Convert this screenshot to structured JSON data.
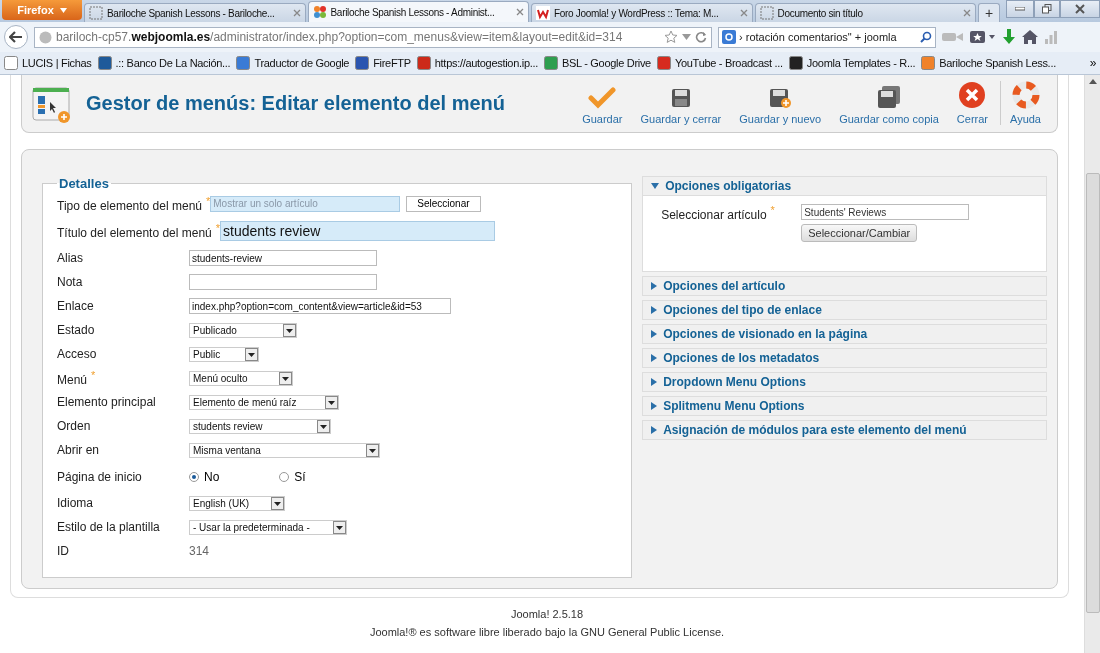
{
  "browser": {
    "menu_button": "Firefox",
    "tabs": [
      {
        "title": "Bariloche Spanish Lessons - Bariloche...",
        "selected": false,
        "kind": "blank"
      },
      {
        "title": "Bariloche Spanish Lessons - Administ...",
        "selected": true,
        "kind": "joomla"
      },
      {
        "title": "Foro Joomla! y WordPress :: Tema: M...",
        "selected": false,
        "kind": "forum"
      },
      {
        "title": "Documento sin título",
        "selected": false,
        "kind": "blank"
      }
    ],
    "new_tab": "+",
    "url": "bariloch-cp57.**webjoomla.es**/administrator/index.php?option=com_menus&view=item&layout=edit&id=314",
    "search": "› rotación comentarios\" + joomla",
    "bookmarks": [
      {
        "label": "LUCIS | Fichas",
        "color": "#ffffff"
      },
      {
        "label": ".:: Banco De La Nación...",
        "color": "#1f5a9a"
      },
      {
        "label": "Traductor de Google",
        "color": "#3a7bd5"
      },
      {
        "label": "FireFTP",
        "color": "#2a55b0"
      },
      {
        "label": "https://autogestion.ip...",
        "color": "#cc2a1a"
      },
      {
        "label": "BSL - Google Drive",
        "color": "#2e9e4f"
      },
      {
        "label": "YouTube - Broadcast ...",
        "color": "#d62b1f"
      },
      {
        "label": "Joomla Templates - R...",
        "color": "#222222"
      },
      {
        "label": "Bariloche Spanish Less...",
        "color": "#f0822a"
      }
    ],
    "more": "»"
  },
  "header": {
    "title": "Gestor de menús: Editar elemento del menú",
    "toolbar": [
      {
        "label": "Guardar",
        "kind": "check"
      },
      {
        "label": "Guardar y cerrar",
        "kind": "save"
      },
      {
        "label": "Guardar y nuevo",
        "kind": "save-new"
      },
      {
        "label": "Guardar como copia",
        "kind": "copy"
      },
      {
        "label": "Cerrar",
        "kind": "close"
      },
      {
        "label": "Ayuda",
        "kind": "help"
      }
    ]
  },
  "details": {
    "legend": "Detalles",
    "fields": [
      {
        "label": "Tipo de elemento del menú",
        "required_mark": "*",
        "kind": "picker",
        "value": "Mostrar un solo artículo",
        "button": "Seleccionar"
      },
      {
        "label": "Título del elemento del menú",
        "required_mark": "*",
        "kind": "big-input",
        "value": "students review"
      },
      {
        "label": "Alias",
        "kind": "input",
        "value": "students-review"
      },
      {
        "label": "Nota",
        "kind": "input"
      },
      {
        "label": "Enlace",
        "kind": "input",
        "value": "index.php?option=com_content&view=article&id=53"
      },
      {
        "label": "Estado",
        "kind": "select",
        "value": "Publicado"
      },
      {
        "label": "Acceso",
        "kind": "select",
        "value": "Public"
      },
      {
        "label": "Menú",
        "required_mark": "*",
        "kind": "select",
        "value": "Menú oculto"
      },
      {
        "label": "Elemento principal",
        "kind": "select",
        "value": "Elemento de menú raíz"
      },
      {
        "label": "Orden",
        "kind": "select",
        "value": "students review"
      },
      {
        "label": "Abrir en",
        "kind": "select",
        "value": "Misma ventana"
      },
      {
        "label": "Página de inicio",
        "kind": "radio",
        "options": [
          {
            "label": "No",
            "selected": true
          },
          {
            "label": "Sí",
            "selected": false
          }
        ]
      },
      {
        "label": "Idioma",
        "kind": "select",
        "value": "English (UK)"
      },
      {
        "label": "Estilo de la plantilla",
        "kind": "select",
        "value": "- Usar la predeterminada -"
      },
      {
        "label": "ID",
        "kind": "text",
        "value": "314"
      }
    ]
  },
  "options": [
    {
      "title": "Opciones obligatorias",
      "expanded": true,
      "field": {
        "label": "Seleccionar artículo",
        "required_mark": "*",
        "value": "Students' Reviews",
        "button": "Seleccionar/Cambiar"
      }
    },
    {
      "title": "Opciones del artículo",
      "expanded": false
    },
    {
      "title": "Opciones del tipo de enlace",
      "expanded": false
    },
    {
      "title": "Opciones de visionado en la página",
      "expanded": false
    },
    {
      "title": "Opciones de los metadatos",
      "expanded": false
    },
    {
      "title": "Dropdown Menu Options",
      "expanded": false
    },
    {
      "title": "Splitmenu Menu Options",
      "expanded": false
    },
    {
      "title": "Asignación de módulos para este elemento del menú",
      "expanded": false
    }
  ],
  "footer": {
    "version": "Joomla! 2.5.18",
    "license": "Joomla!® es software libre liberado bajo la GNU General Public License."
  }
}
